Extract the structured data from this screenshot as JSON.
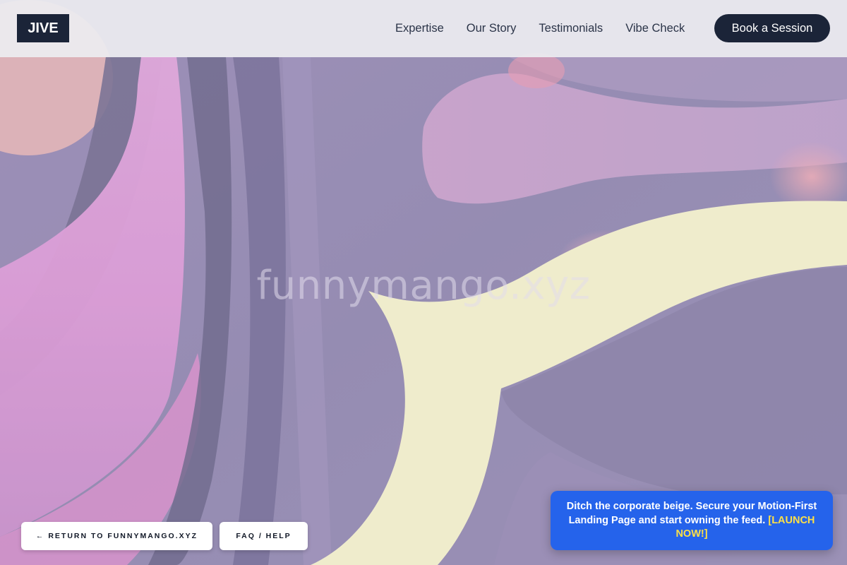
{
  "header": {
    "logo_text": "JIVE",
    "nav_items": [
      {
        "label": "Expertise"
      },
      {
        "label": "Our Story"
      },
      {
        "label": "Testimonials"
      },
      {
        "label": "Vibe Check"
      }
    ],
    "cta_label": "Book a Session"
  },
  "hero": {
    "watermark": "funnymango.xyz"
  },
  "footer_actions": {
    "return_label": "← RETURN TO FUNNYMANGO.XYZ",
    "faq_label": "FAQ / HELP"
  },
  "promo": {
    "text": "Ditch the corporate beige. Secure your Motion-First Landing Page and start owning the feed.",
    "link_text": "[LAUNCH NOW!]"
  },
  "colors": {
    "navy": "#1b2438",
    "promo_blue": "#2563eb",
    "promo_link_yellow": "#fde047",
    "hero_cream": "#fbf8c4"
  }
}
